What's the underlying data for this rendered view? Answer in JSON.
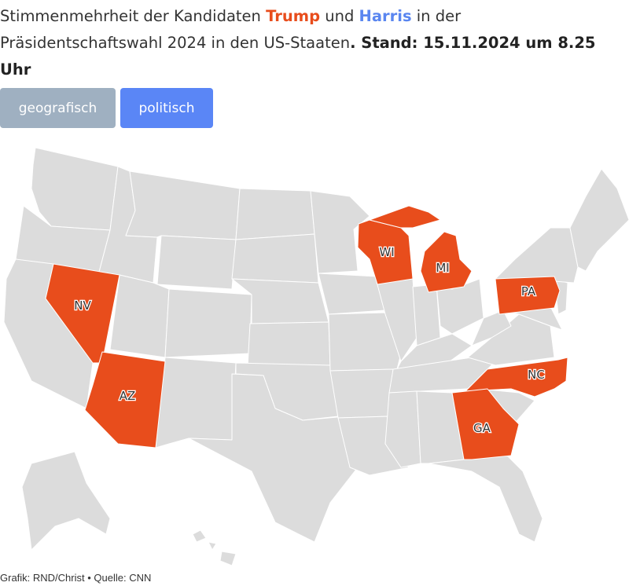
{
  "title": {
    "part1": "Stimmenmehrheit der Kandidaten ",
    "trump": "Trump",
    "part2": " und ",
    "harris": "Harris",
    "part3": " in der Präsidentschaftswahl 2024 in den US-Staaten",
    "stand": ". Stand: 15.11.2024 um 8.25 Uhr"
  },
  "tabs": {
    "geo": "geografisch",
    "pol": "politisch"
  },
  "colors": {
    "trump": "#e84d1c",
    "harris": "#5a86f0",
    "neutral": "#dcdcdc",
    "border": "#ffffff"
  },
  "states": {
    "nv": "NV",
    "az": "AZ",
    "wi": "WI",
    "mi": "MI",
    "pa": "PA",
    "nc": "NC",
    "ga": "GA"
  },
  "footer": "Grafik: RND/Christ • Quelle: CNN"
}
